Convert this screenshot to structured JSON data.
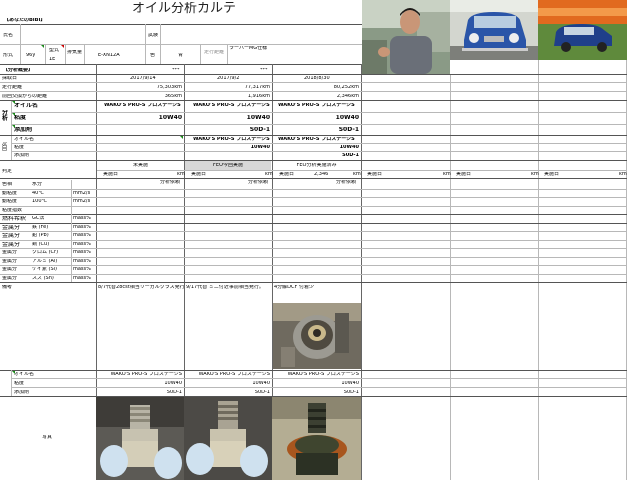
{
  "header": {
    "title": "オイル分析カルテ",
    "owner_label": "【あなたのBIBI】",
    "name_label": "氏名",
    "test_label": "試験",
    "model_label": "形式",
    "year_label": "年式",
    "year_value": "96y",
    "engine_label": "型式",
    "engine_sub": "排気量",
    "cc_value": "1E",
    "mileage_label": "走行距離",
    "car_code": "E-XN12A",
    "color_label": "色",
    "color_value": "青",
    "shop": "ラーバーMG仕様"
  },
  "analysis_header": "【分析概要】",
  "rows": {
    "sample_date": {
      "label": "採取日",
      "values": [
        "2017/9/14",
        "2017/9/2",
        "2018/8/30"
      ],
      "extra": [
        "***",
        "***"
      ]
    },
    "odometer": {
      "label": "走行距離",
      "values": [
        "75,303km",
        "77,317km",
        "80,252km"
      ]
    },
    "since_change": {
      "label": "前回交換からの距離",
      "values": [
        "365km",
        "1,916km",
        "2,346km"
      ]
    },
    "oil_name": {
      "label": "オイル名",
      "values": [
        "WAKO'S PRO-S プロステージS",
        "WAKO'S PRO-S プロステージS",
        "WAKO'S PRO-S プロステージS"
      ]
    },
    "viscosity": {
      "label": "粘度",
      "values": [
        "10W40",
        "10W40",
        "10W40"
      ]
    },
    "additive": {
      "label": "添加剤",
      "values": [
        "",
        "S0D-1",
        "S0D-1"
      ]
    },
    "oil_name2": {
      "label": "オイル名",
      "values": [
        "WAKO'S PRO-S プロステージS",
        "WAKO'S PRO-S プロステージS",
        "WAKO'S PRO-S プロステージS"
      ]
    },
    "viscosity2": {
      "label": "粘度",
      "values": [
        "",
        "10W40",
        "10W40"
      ]
    },
    "additive2": {
      "label": "添加剤",
      "values": [
        "",
        "",
        "S0D-1"
      ]
    }
  },
  "side_labels": {
    "analysis": "分析",
    "next": "次回"
  },
  "status": {
    "label": "判定",
    "values": [
      "未実施",
      "FEO今回実施",
      "FEO分析実施済み"
    ],
    "row_labels": [
      "実施日",
      "実施日",
      "実施日",
      "実施日",
      "実施日",
      "実施日",
      "実施日"
    ],
    "unit": "km",
    "measured": [
      "",
      "",
      "2,346"
    ]
  },
  "metrics": [
    {
      "label": "色相",
      "sub": "水分",
      "unit": ""
    },
    {
      "label": "動粘度",
      "sub": "40℃",
      "unit": "mm2/s"
    },
    {
      "label": "動粘度",
      "sub": "100℃",
      "unit": "mm2/s"
    },
    {
      "label": "粘度指数",
      "sub": "",
      "unit": ""
    },
    {
      "label": "燃料希釈",
      "sub": "GC法",
      "unit": "mass%"
    },
    {
      "label": "金属分",
      "sub": "鉄 (Fe)",
      "unit": "mass%"
    },
    {
      "label": "金属分",
      "sub": "鉛 (Pb)",
      "unit": "mass%"
    },
    {
      "label": "金属分",
      "sub": "銅 (Cu)",
      "unit": "mass%"
    },
    {
      "label": "金属分",
      "sub": "クロム (Cr)",
      "unit": "mass%"
    },
    {
      "label": "金属分",
      "sub": "アルミ (Al)",
      "unit": "mass%"
    },
    {
      "label": "金属分",
      "sub": "ケイ素 (Si)",
      "unit": "mass%"
    },
    {
      "label": "金属分",
      "sub": "スズ (Sn)",
      "unit": "mass%"
    }
  ],
  "split_label": "分析依頼",
  "notes": {
    "label": "備考",
    "values": [
      "8/7代替28cst相当リーガルクラス発行",
      "9/17代替 ミニ付近事前相当発行。",
      "4分解DCF 付着少"
    ]
  },
  "bottom": {
    "oil_label": "オイル名",
    "visc_label": "粘度",
    "add_label": "添加剤",
    "oil_values": [
      "WAKO'S PRO-S プロステージS",
      "WAKO'S PRO-S プロステージS",
      "WAKO'S PRO-S プロステージS"
    ],
    "visc_values": [
      "10W40",
      "10W40",
      "10W40"
    ],
    "add_values": [
      "S0D-1",
      "S0D-1",
      "S0D-1"
    ],
    "photo_label": "写真"
  },
  "colors": {
    "tri": "#1a8a1a",
    "status_bg": "#d8d8d8"
  }
}
